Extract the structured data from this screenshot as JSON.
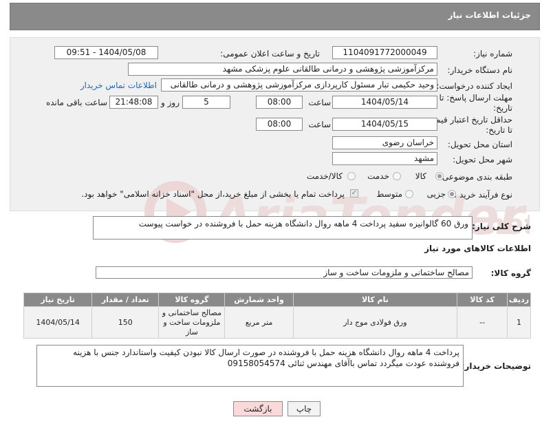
{
  "header": {
    "title": "جزئیات اطلاعات نیاز"
  },
  "form": {
    "need_number": {
      "label": "شماره نیاز:",
      "value": "1104091772000049"
    },
    "announce_datetime": {
      "label": "تاریخ و ساعت اعلان عمومی:",
      "value": "1404/05/08 - 09:51"
    },
    "buyer_org": {
      "label": "نام دستگاه خریدار:",
      "value": "مرکزآموزشی  پژوهشی و درمانی طالقانی   علوم پزشکی مشهد"
    },
    "requester": {
      "label": "ایجاد کننده درخواست:",
      "value": "وحید حکیمی تبار مسئول کارپردازی مرکزآموزشی  پژوهشی و درمانی طالقانی",
      "contact_link": "اطلاعات تماس خریدار"
    },
    "reply_deadline": {
      "label_line1": "مهلت ارسال پاسخ: تا",
      "label_line2": "تاریخ:",
      "date": "1404/05/14",
      "time_label": "ساعت",
      "time": "08:00",
      "days": "5",
      "days_label": "روز و",
      "remaining": "21:48:08",
      "remaining_label": "ساعت باقی مانده"
    },
    "price_validity": {
      "label_line1": "حداقل تاریخ اعتبار قیمت:",
      "label_line2": "تا تاریخ:",
      "date": "1404/05/15",
      "time_label": "ساعت",
      "time": "08:00"
    },
    "delivery_province": {
      "label": "استان محل تحویل:",
      "value": "خراسان رضوی"
    },
    "delivery_city": {
      "label": "شهر محل تحویل:",
      "value": "مشهد"
    },
    "category": {
      "label": "طبقه بندی موضوعی:",
      "options": [
        "کالا",
        "خدمت",
        "کالا/خدمت"
      ],
      "selected": "کالا"
    },
    "purchase_process": {
      "label": "نوع فرآیند خرید :",
      "options": [
        "جزیی",
        "متوسط"
      ],
      "selected": "جزیی",
      "note": "پرداخت تمام یا بخشی از مبلغ خرید،از محل \"اسناد خزانه اسلامی\" خواهد بود."
    }
  },
  "summary": {
    "label": "شرح کلی نیاز:",
    "value": "ورق 60 گالوانیزه سفید پرداخت 4 ماهه روال دانشگاه هزینه حمل با فروشنده در خواست پیوست"
  },
  "goods_section": {
    "title": "اطلاعات کالاهای مورد نیاز",
    "group_label": "گروه کالا:",
    "group_value": "مصالح ساختمانی و ملزومات ساخت و ساز",
    "columns": [
      "ردیف",
      "کد کالا",
      "نام کالا",
      "واحد شمارش",
      "گروه کالا",
      "تعداد / مقدار",
      "تاریخ نیاز"
    ],
    "rows": [
      {
        "row": "1",
        "code": "--",
        "name": "ورق فولادی موج دار",
        "unit": "متر مربع",
        "group": "مصالح ساختمانی و ملزومات ساخت و ساز",
        "qty": "150",
        "date": "1404/05/14"
      }
    ]
  },
  "buyer_notes": {
    "label": "توضیحات خریدار:",
    "value": "پرداخت 4 ماهه روال دانشگاه هزینه حمل با فروشنده در صورت ارسال کالا نبودن کیفیت واستاندارد جنس با هزینه فروشنده عودت میگردد تماس باآقای مهندس ثنائی 09158054574"
  },
  "buttons": {
    "print": "چاپ",
    "back": "بازگشت"
  },
  "colors": {
    "header_bg": "#8a8a8a",
    "link": "#1d6ab5",
    "back_button_bg": "#f9d9d9",
    "watermark": "#e6c9c9"
  }
}
